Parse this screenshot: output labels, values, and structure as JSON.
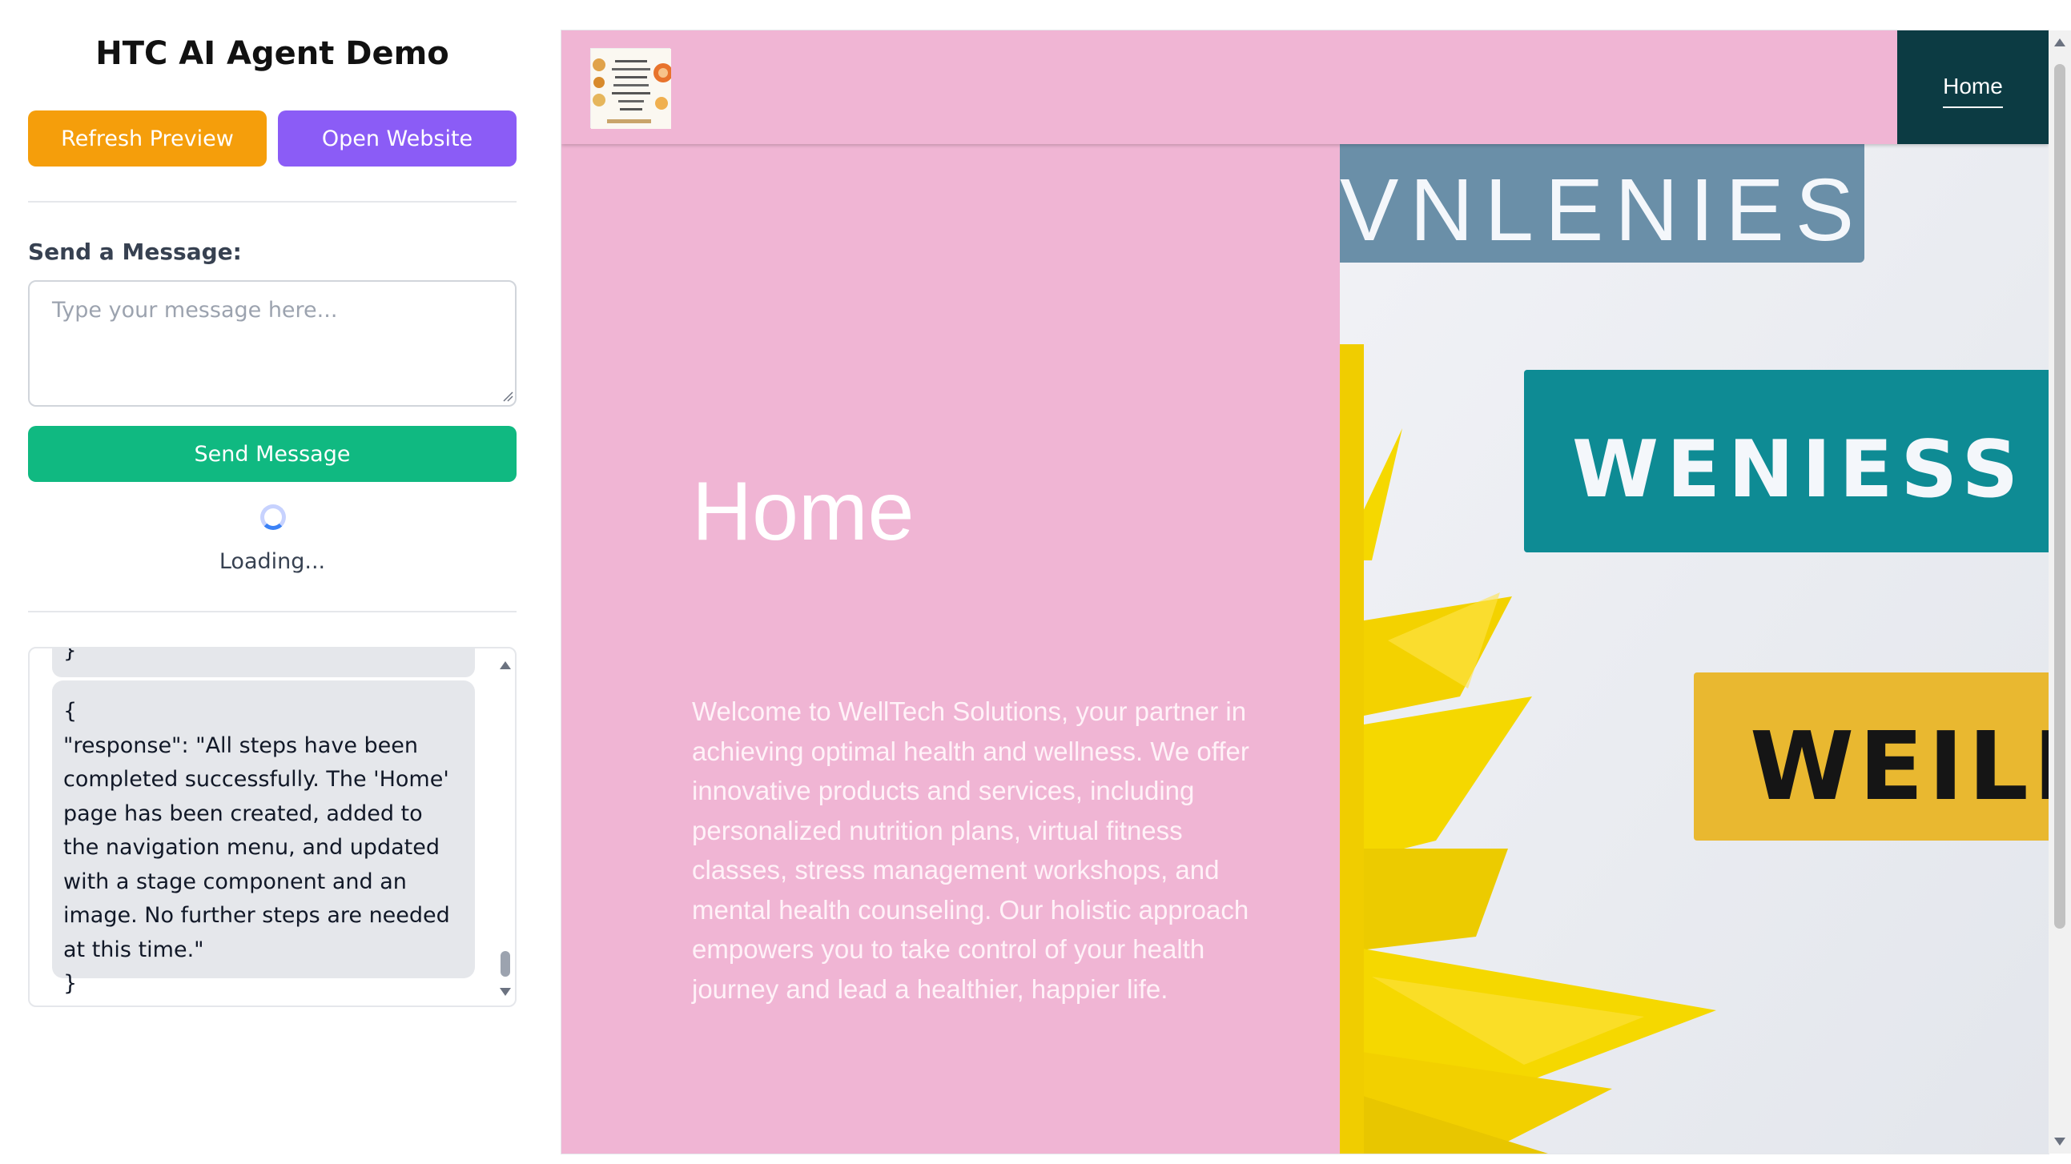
{
  "app": {
    "title": "HTC AI Agent Demo"
  },
  "toolbar": {
    "refresh_label": "Refresh Preview",
    "open_label": "Open Website"
  },
  "composer": {
    "label": "Send a Message:",
    "placeholder": "Type your message here...",
    "value": "",
    "send_label": "Send Message"
  },
  "status": {
    "loading_text": "Loading..."
  },
  "chat": {
    "previous_fragment": "}",
    "messages": [
      {
        "text": "{\n\"response\": \"All steps have been completed successfully. The 'Home' page has been created, added to the navigation menu, and updated with a stage component and an image. No further steps are needed at this time.\"\n}"
      }
    ]
  },
  "website": {
    "nav": {
      "items": [
        {
          "label": "Home",
          "active": true
        }
      ]
    },
    "logo": {
      "icon": "wellness-logo-icon"
    },
    "hero": {
      "title": "Home",
      "text": "Welcome to WellTech Solutions, your partner in achieving optimal health and wellness. We offer innovative products and services, including personalized nutrition plans, virtual fitness classes, stress management workshops, and mental health counseling. Our holistic approach empowers you to take control of your health journey and lead a healthier, happier life.",
      "image_signs": [
        "VNLENIES",
        "WENIESS",
        "WEILN"
      ]
    }
  },
  "colors": {
    "refresh": "#f59e0b",
    "open": "#8b5cf6",
    "send": "#10b981",
    "site_bg": "#f0b5d4",
    "nav_bg": "#0c3b43",
    "sign_blue": "#6a8fa8",
    "sign_teal": "#0e8b94",
    "sign_yellow": "#e9b830",
    "flower": "#f5d800"
  }
}
